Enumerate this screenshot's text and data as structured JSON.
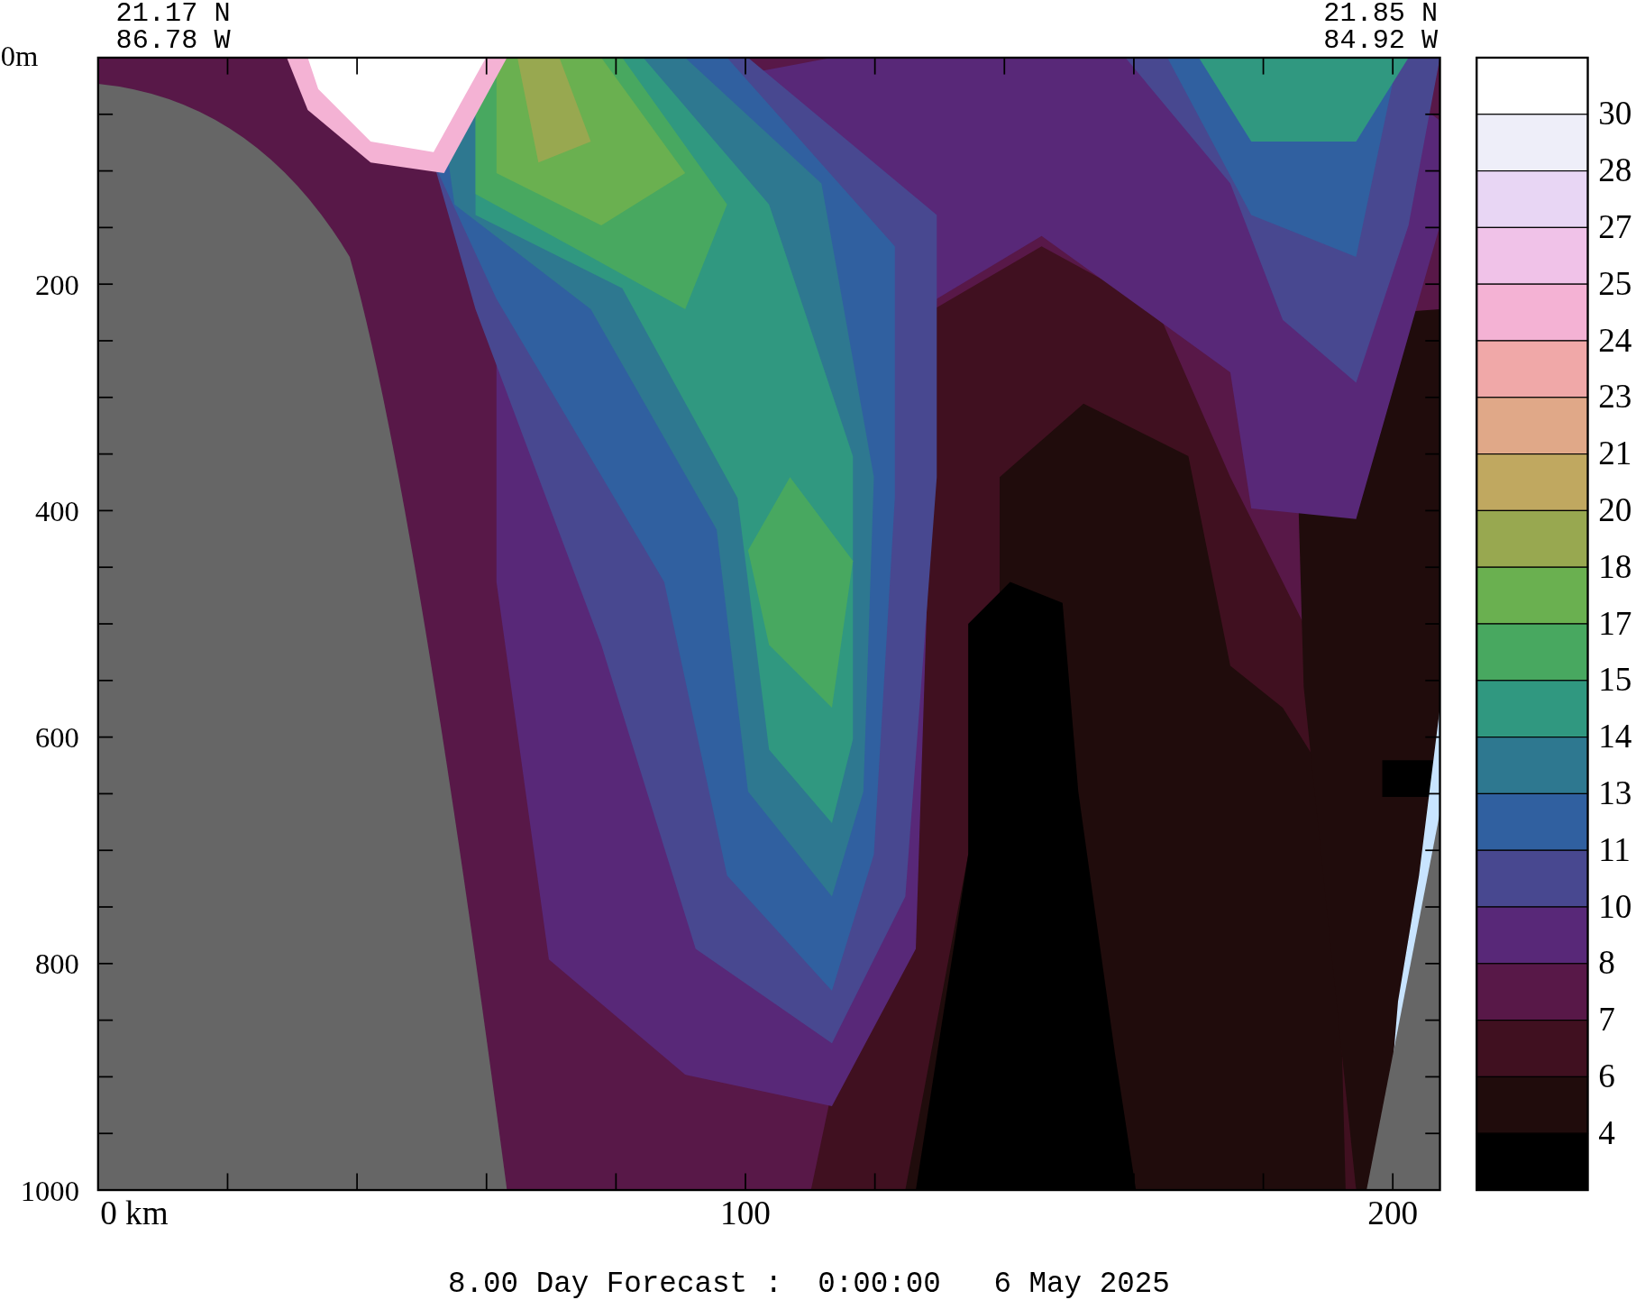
{
  "top_labels": {
    "left": [
      "21.17 N",
      "86.78 W"
    ],
    "right": [
      "21.85 N",
      "84.92 W"
    ]
  },
  "y_axis": {
    "ticks": [
      "0m",
      "200",
      "400",
      "600",
      "800",
      "1000"
    ]
  },
  "x_axis": {
    "ticks": [
      "0 km",
      "100",
      "200"
    ]
  },
  "colorbar": {
    "bands": [
      {
        "color": "#ffffff"
      },
      {
        "color": "#eeeef9"
      },
      {
        "color": "#e8d6f4"
      },
      {
        "color": "#f0c2e8"
      },
      {
        "color": "#f4b2d4"
      },
      {
        "color": "#f0a8a8"
      },
      {
        "color": "#e0a888"
      },
      {
        "color": "#c0a860"
      },
      {
        "color": "#98a850"
      },
      {
        "color": "#6ab050"
      },
      {
        "color": "#48a860"
      },
      {
        "color": "#309880"
      },
      {
        "color": "#2e7890"
      },
      {
        "color": "#3060a0"
      },
      {
        "color": "#484890"
      },
      {
        "color": "#582878"
      },
      {
        "color": "#581848"
      },
      {
        "color": "#401020"
      },
      {
        "color": "#200c0c"
      },
      {
        "color": "#000000"
      }
    ],
    "labels": [
      "30",
      "28",
      "27",
      "25",
      "24",
      "23",
      "21",
      "20",
      "18",
      "17",
      "15",
      "14",
      "13",
      "11",
      "10",
      "8",
      "7",
      "6",
      "4"
    ]
  },
  "caption": "8.00 Day Forecast :  0:00:00   6 May 2025"
}
